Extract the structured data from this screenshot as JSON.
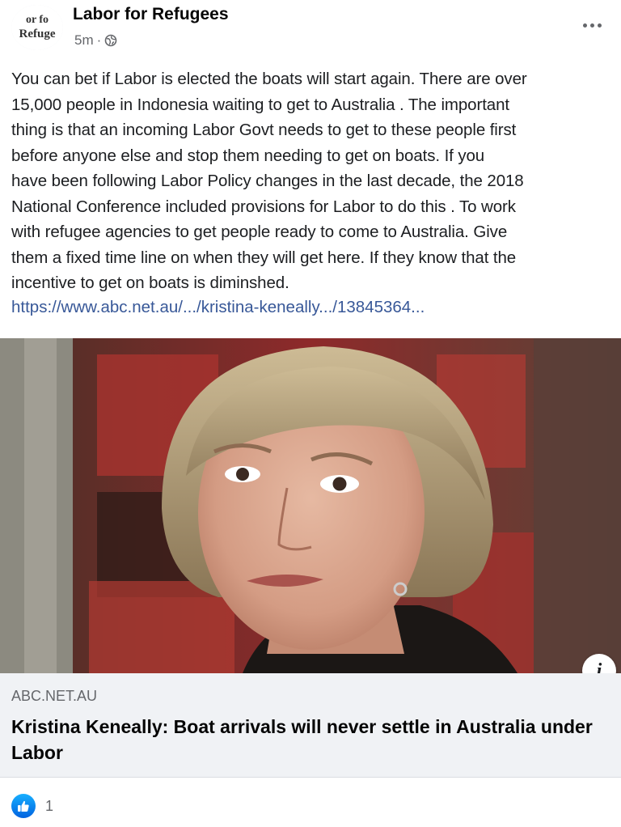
{
  "post": {
    "page_name": "Labor for Refugees",
    "avatar_text_top": "or fo",
    "avatar_text_bottom": "Refuge",
    "timestamp": "5m",
    "separator": "·",
    "privacy_icon": "globe-icon",
    "more_icon": "more-options-icon",
    "text_lines": [
      "You can bet if Labor is elected the boats will start again. There are over",
      "15,000 people in Indonesia waiting to get to Australia . The important",
      "thing is that an incoming Labor Govt needs to get to these people first",
      "before anyone else and stop them needing to get on boats. If you",
      "have been following Labor Policy changes in the last decade, the 2018",
      "National Conference included provisions for Labor to do this . To work",
      "with refugee agencies to get people ready to come to Australia. Give",
      "them a fixed time line on when they will get here. If they know that the",
      "incentive to get on boats is diminshed."
    ],
    "link_text": "https://www.abc.net.au/.../kristina-keneally.../13845364..."
  },
  "link_preview": {
    "domain": "ABC.NET.AU",
    "title": "Kristina Keneally: Boat arrivals will never settle in Australia under Labor",
    "info_label": "i"
  },
  "reactions": {
    "icon": "like-icon",
    "count": "1"
  },
  "colors": {
    "link": "#385898",
    "secondary_text": "#65676b",
    "card_background": "#f0f2f5",
    "like_blue": "#0062df"
  }
}
